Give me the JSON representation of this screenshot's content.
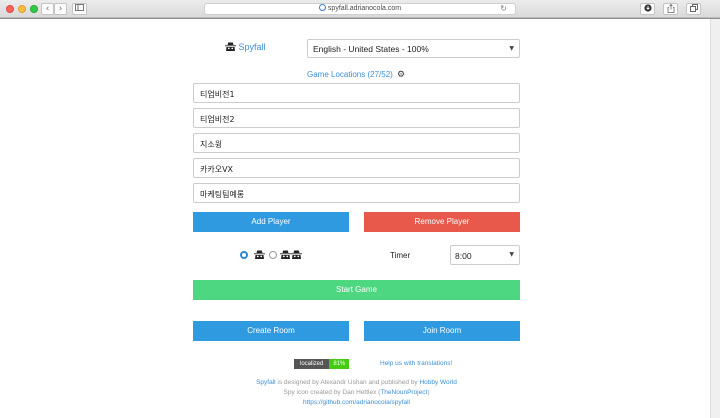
{
  "browser": {
    "url": "spyfall.adrianocola.com",
    "back_icon": "‹",
    "forward_icon": "›"
  },
  "header": {
    "app_name": "Spyfall",
    "language_selected": "English - United States - 100%"
  },
  "locations": {
    "label": "Game Locations (27/52)"
  },
  "players": [
    "티업비전1",
    "티업비전2",
    "지소윙",
    "카카오VX",
    "마케팅팀예롱"
  ],
  "buttons": {
    "add_player": "Add Player",
    "remove_player": "Remove Player",
    "start_game": "Start Game",
    "create_room": "Create Room",
    "join_room": "Join Room"
  },
  "options": {
    "spy_count_selected": 1,
    "timer_label": "Timer",
    "timer_value": "8:00"
  },
  "translation": {
    "badge_left": "localized",
    "badge_right": "81%",
    "help_link": "Help us with translations!"
  },
  "footer": {
    "line1_link1": "Spyfall",
    "line1_mid": " is designed by Alexandr Ushan and published by ",
    "line1_link2": "Hobby World",
    "line2_pre": "Spy icon created by Dan Hettlex (",
    "line2_link": "TheNounProject",
    "line2_post": ")",
    "line3_link": "https://github.com/adrianocola/spyfall"
  },
  "colors": {
    "primary_blue": "#2f9ae0",
    "danger_red": "#e8594b",
    "success_green": "#4cd780",
    "link_blue": "#3d8fd6"
  }
}
